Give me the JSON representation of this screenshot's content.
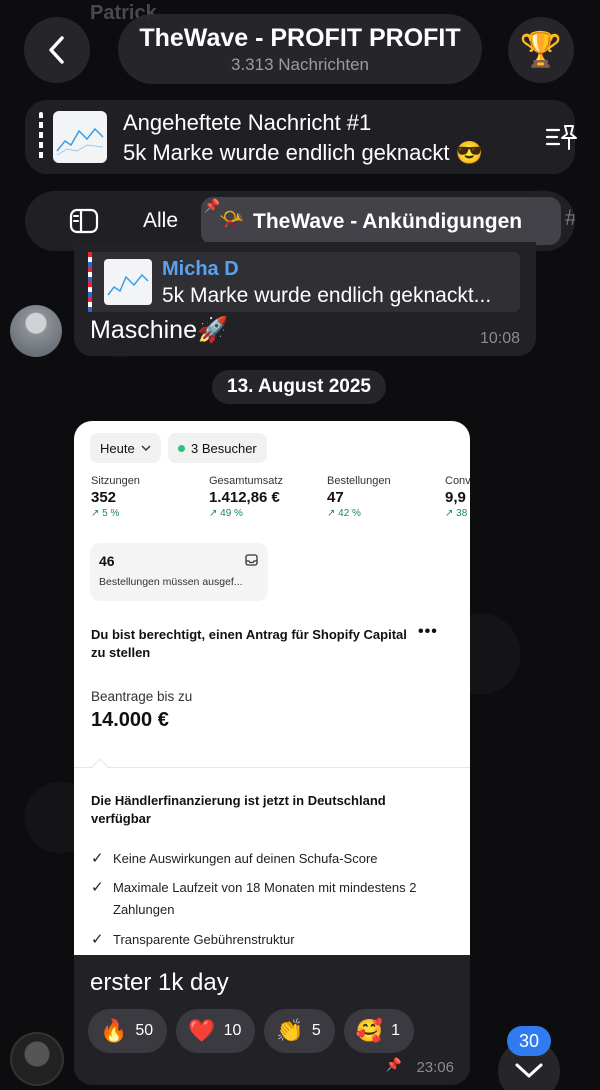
{
  "background_partial_name": "Patrick",
  "header": {
    "title": "TheWave - PROFIT PROFIT",
    "subtitle": "3.313 Nachrichten",
    "back_icon": "chevron-left-icon",
    "trophy_icon": "🏆"
  },
  "pinned": {
    "title": "Angeheftete Nachricht #1",
    "text": "5k Marke wurde endlich geknackt 😎"
  },
  "topics": {
    "all_label": "Alle",
    "active_icon": "📯",
    "active_label": "TheWave - Ankündigungen",
    "next_label": "#"
  },
  "message1": {
    "reply_name": "Micha D",
    "reply_text": "5k Marke wurde endlich geknackt...",
    "text": "Maschine🚀",
    "time": "10:08"
  },
  "date_separator": "13. August 2025",
  "screenshot": {
    "dropdown": "Heute",
    "visitors": "3 Besucher",
    "metrics": [
      {
        "label": "Sitzungen",
        "value": "352",
        "change": "↗ 5 %"
      },
      {
        "label": "Gesamtumsatz",
        "value": "1.412,86 €",
        "change": "↗ 49 %"
      },
      {
        "label": "Bestellungen",
        "value": "47",
        "change": "↗ 42 %"
      },
      {
        "label": "Conv",
        "value": "9,9",
        "change": "↗ 38"
      }
    ],
    "orders_count": "46",
    "orders_text": "Bestellungen müssen ausgef...",
    "capital_title": "Du bist berechtigt, einen Antrag für Shopify Capital zu stellen",
    "capital_more": "•••",
    "apply_label": "Beantrage bis zu",
    "amount": "14.000 €",
    "financing_title": "Die Händlerfinanzierung ist jetzt in Deutschland verfügbar",
    "checks": [
      "Keine Auswirkungen auf deinen Schufa-Score",
      "Maximale Laufzeit von 18 Monaten mit mindestens 2 Zahlungen",
      "Transparente Gebührenstruktur"
    ]
  },
  "message2": {
    "caption": "erster 1k day",
    "reactions": [
      {
        "emoji": "🔥",
        "count": "50"
      },
      {
        "emoji": "❤️",
        "count": "10"
      },
      {
        "emoji": "👏",
        "count": "5"
      },
      {
        "emoji": "🥰",
        "count": "1"
      }
    ],
    "time": "23:06"
  },
  "unread_count": "30",
  "colors": {
    "accent_blue": "#2f7bef",
    "reply_name": "#5aa1f0",
    "positive_change": "#1a8a55"
  }
}
